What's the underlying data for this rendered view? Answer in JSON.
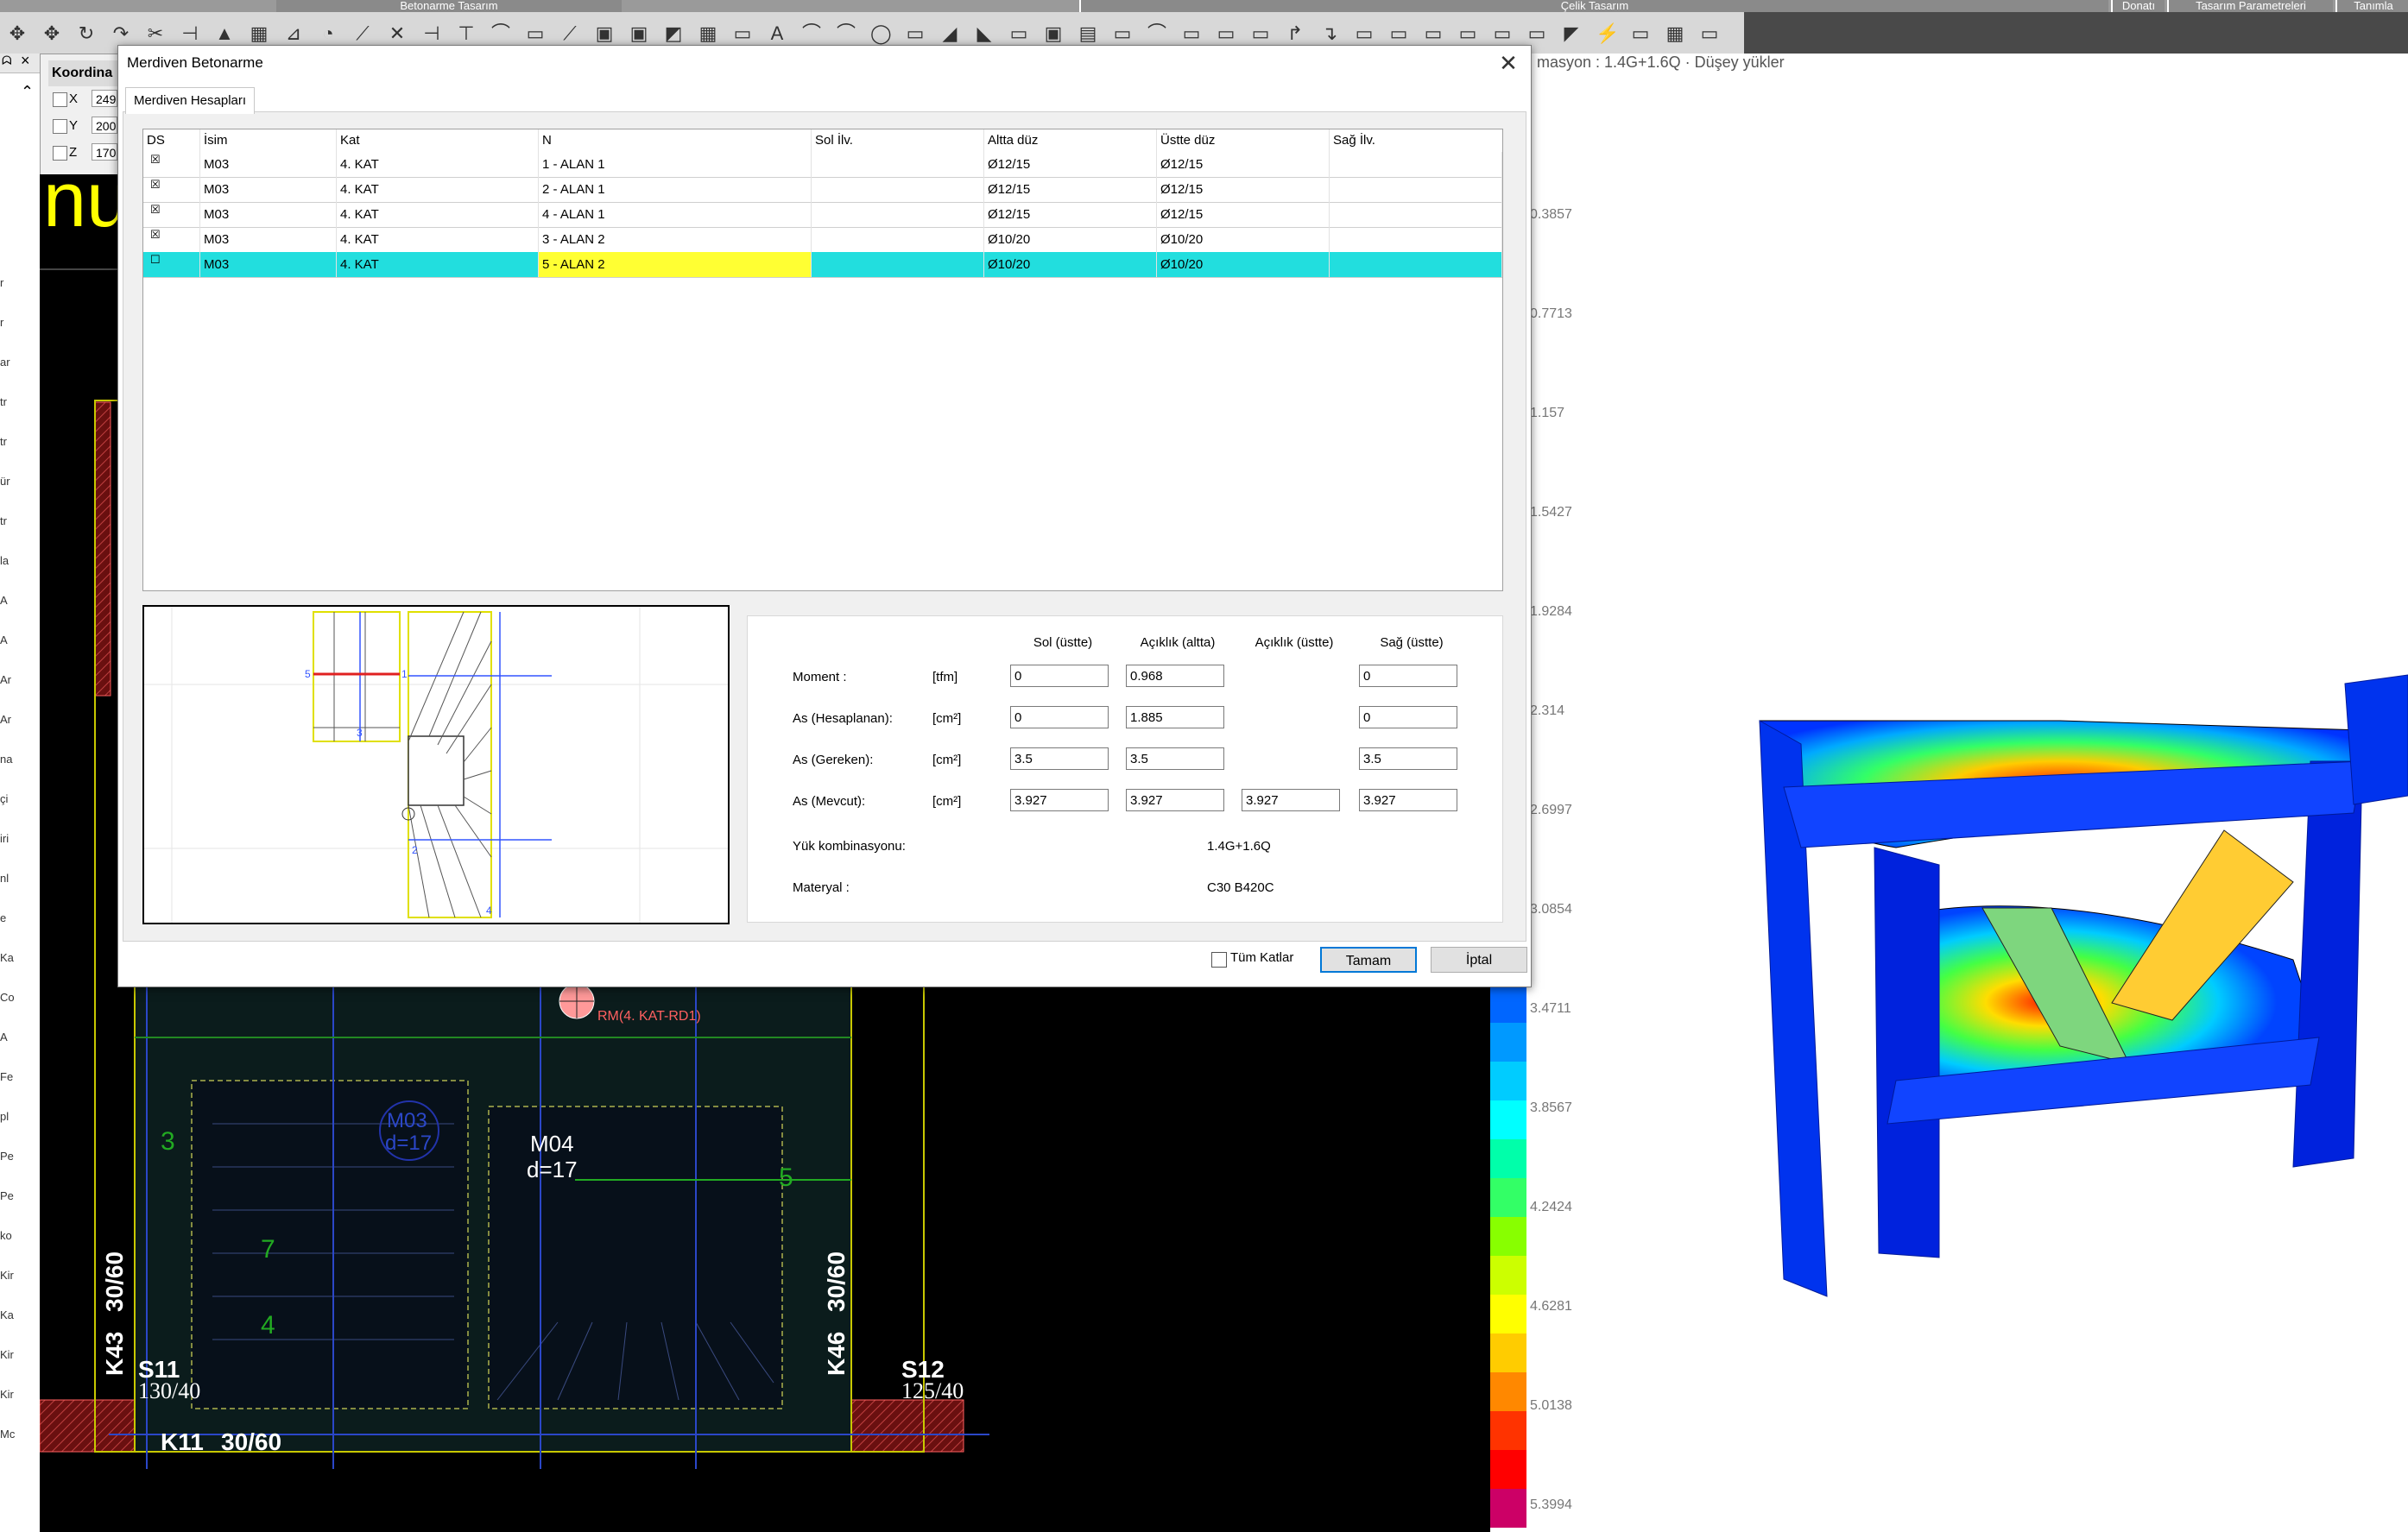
{
  "app": {
    "top_sections": [
      "Betonarme Tasarım",
      "Çelik Tasarım",
      "Donatı",
      "Tasarım Parametreleri",
      "Tanımla"
    ]
  },
  "side": {
    "header_icon": "pin-icon",
    "close_icon": "close-icon",
    "letters": [
      "r",
      "r",
      "ar",
      "tr",
      "tr",
      "ür",
      "tr",
      "la",
      "A",
      "A",
      "Ar",
      "Ar",
      "na",
      "çi",
      "iri",
      "nl",
      "e",
      "Ka",
      "Co",
      "A",
      "Fe",
      "pl",
      "Pe",
      "Pe",
      "ko",
      "Kir",
      "Ka",
      "Kir",
      "Kir",
      "Mc"
    ]
  },
  "coordinates": {
    "tab_label": "Koordina",
    "rows": [
      {
        "label": "X",
        "value": "249"
      },
      {
        "label": "Y",
        "value": "200"
      },
      {
        "label": "Z",
        "value": "170"
      }
    ]
  },
  "cad": {
    "big_text": "nu",
    "labels": {
      "k43": "K43",
      "k43_size": "30/60",
      "k46": "K46",
      "k46_size": "30/60",
      "s11": "S11",
      "s11_size": "130/40",
      "s12": "S12",
      "s12_size": "125/40",
      "k11": "K11",
      "k11_size": "30/60",
      "m03": "M03",
      "m03_d": "d=17",
      "m04": "M04",
      "m04_d": "d=17",
      "rm": "RM(4. KAT-RD1)",
      "n3": "3",
      "n4": "4",
      "n5": "5",
      "n7": "7"
    }
  },
  "right": {
    "info": "masyon : 1.4G+1.6Q  ·  Düşey yükler",
    "legend": [
      "0.3857",
      "0.7713",
      "1.157",
      "1.5427",
      "1.9284",
      "2.314",
      "2.6997",
      "3.0854",
      "3.4711",
      "3.8567",
      "4.2424",
      "4.6281",
      "5.0138",
      "5.3994"
    ],
    "legend_colors": [
      "#0000ff",
      "#0033ff",
      "#0066ff",
      "#0099ff",
      "#00ccff",
      "#00ffff",
      "#00ffaa",
      "#33ff66",
      "#88ff00",
      "#ccff00",
      "#ffff00",
      "#ffcc00",
      "#ff8800",
      "#ff3300",
      "#ff0000",
      "#cc0066"
    ]
  },
  "dialog": {
    "title": "Merdiven Betonarme",
    "tab": "Merdiven Hesapları",
    "columns": [
      "DS",
      "İsim",
      "Kat",
      "N",
      "Sol İlv.",
      "Altta düz",
      "Üstte düz",
      "Sağ İlv."
    ],
    "rows": [
      {
        "checked": true,
        "isim": "M03",
        "kat": "4. KAT",
        "n": "1 - ALAN 1",
        "sol": "",
        "altta": "Ø12/15",
        "ustte": "Ø12/15",
        "sag": ""
      },
      {
        "checked": true,
        "isim": "M03",
        "kat": "4. KAT",
        "n": "2 - ALAN 1",
        "sol": "",
        "altta": "Ø12/15",
        "ustte": "Ø12/15",
        "sag": ""
      },
      {
        "checked": true,
        "isim": "M03",
        "kat": "4. KAT",
        "n": "4 - ALAN 1",
        "sol": "",
        "altta": "Ø12/15",
        "ustte": "Ø12/15",
        "sag": ""
      },
      {
        "checked": true,
        "isim": "M03",
        "kat": "4. KAT",
        "n": "3 - ALAN 2",
        "sol": "",
        "altta": "Ø10/20",
        "ustte": "Ø10/20",
        "sag": ""
      },
      {
        "checked": false,
        "isim": "M03",
        "kat": "4. KAT",
        "n": "5 - ALAN 2",
        "sol": "",
        "altta": "Ø10/20",
        "ustte": "Ø10/20",
        "sag": "",
        "selected": true
      }
    ],
    "preview_labels": [
      "5",
      "1",
      "3",
      "2",
      "4"
    ],
    "results": {
      "headers": [
        "Sol (üstte)",
        "Açıklık (altta)",
        "Açıklık (üstte)",
        "Sağ (üstte)"
      ],
      "rows": [
        {
          "label": "Moment :",
          "unit": "[tfm]",
          "values": [
            "0",
            "0.968",
            null,
            "0"
          ]
        },
        {
          "label": "As (Hesaplanan):",
          "unit": "[cm²]",
          "values": [
            "0",
            "1.885",
            null,
            "0"
          ]
        },
        {
          "label": "As (Gereken):",
          "unit": "[cm²]",
          "values": [
            "3.5",
            "3.5",
            null,
            "3.5"
          ]
        },
        {
          "label": "As (Mevcut):",
          "unit": "[cm²]",
          "values": [
            "3.927",
            "3.927",
            "3.927",
            "3.927"
          ]
        }
      ],
      "combo_label": "Yük kombinasyonu:",
      "combo_value": "1.4G+1.6Q",
      "material_label": "Materyal :",
      "material_value": "C30 B420C"
    },
    "all_floors_label": "Tüm Katlar",
    "ok_label": "Tamam",
    "cancel_label": "İptal"
  }
}
